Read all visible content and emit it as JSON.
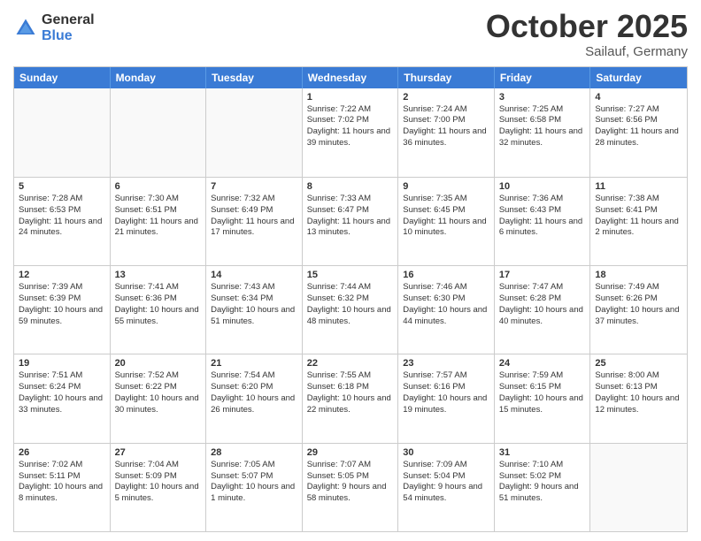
{
  "header": {
    "logo": {
      "general": "General",
      "blue": "Blue"
    },
    "title": "October 2025",
    "subtitle": "Sailauf, Germany"
  },
  "days_of_week": [
    "Sunday",
    "Monday",
    "Tuesday",
    "Wednesday",
    "Thursday",
    "Friday",
    "Saturday"
  ],
  "weeks": [
    [
      {
        "num": "",
        "empty": true
      },
      {
        "num": "",
        "empty": true
      },
      {
        "num": "",
        "empty": true
      },
      {
        "num": "1",
        "sunrise": "Sunrise: 7:22 AM",
        "sunset": "Sunset: 7:02 PM",
        "daylight": "Daylight: 11 hours and 39 minutes."
      },
      {
        "num": "2",
        "sunrise": "Sunrise: 7:24 AM",
        "sunset": "Sunset: 7:00 PM",
        "daylight": "Daylight: 11 hours and 36 minutes."
      },
      {
        "num": "3",
        "sunrise": "Sunrise: 7:25 AM",
        "sunset": "Sunset: 6:58 PM",
        "daylight": "Daylight: 11 hours and 32 minutes."
      },
      {
        "num": "4",
        "sunrise": "Sunrise: 7:27 AM",
        "sunset": "Sunset: 6:56 PM",
        "daylight": "Daylight: 11 hours and 28 minutes."
      }
    ],
    [
      {
        "num": "5",
        "sunrise": "Sunrise: 7:28 AM",
        "sunset": "Sunset: 6:53 PM",
        "daylight": "Daylight: 11 hours and 24 minutes."
      },
      {
        "num": "6",
        "sunrise": "Sunrise: 7:30 AM",
        "sunset": "Sunset: 6:51 PM",
        "daylight": "Daylight: 11 hours and 21 minutes."
      },
      {
        "num": "7",
        "sunrise": "Sunrise: 7:32 AM",
        "sunset": "Sunset: 6:49 PM",
        "daylight": "Daylight: 11 hours and 17 minutes."
      },
      {
        "num": "8",
        "sunrise": "Sunrise: 7:33 AM",
        "sunset": "Sunset: 6:47 PM",
        "daylight": "Daylight: 11 hours and 13 minutes."
      },
      {
        "num": "9",
        "sunrise": "Sunrise: 7:35 AM",
        "sunset": "Sunset: 6:45 PM",
        "daylight": "Daylight: 11 hours and 10 minutes."
      },
      {
        "num": "10",
        "sunrise": "Sunrise: 7:36 AM",
        "sunset": "Sunset: 6:43 PM",
        "daylight": "Daylight: 11 hours and 6 minutes."
      },
      {
        "num": "11",
        "sunrise": "Sunrise: 7:38 AM",
        "sunset": "Sunset: 6:41 PM",
        "daylight": "Daylight: 11 hours and 2 minutes."
      }
    ],
    [
      {
        "num": "12",
        "sunrise": "Sunrise: 7:39 AM",
        "sunset": "Sunset: 6:39 PM",
        "daylight": "Daylight: 10 hours and 59 minutes."
      },
      {
        "num": "13",
        "sunrise": "Sunrise: 7:41 AM",
        "sunset": "Sunset: 6:36 PM",
        "daylight": "Daylight: 10 hours and 55 minutes."
      },
      {
        "num": "14",
        "sunrise": "Sunrise: 7:43 AM",
        "sunset": "Sunset: 6:34 PM",
        "daylight": "Daylight: 10 hours and 51 minutes."
      },
      {
        "num": "15",
        "sunrise": "Sunrise: 7:44 AM",
        "sunset": "Sunset: 6:32 PM",
        "daylight": "Daylight: 10 hours and 48 minutes."
      },
      {
        "num": "16",
        "sunrise": "Sunrise: 7:46 AM",
        "sunset": "Sunset: 6:30 PM",
        "daylight": "Daylight: 10 hours and 44 minutes."
      },
      {
        "num": "17",
        "sunrise": "Sunrise: 7:47 AM",
        "sunset": "Sunset: 6:28 PM",
        "daylight": "Daylight: 10 hours and 40 minutes."
      },
      {
        "num": "18",
        "sunrise": "Sunrise: 7:49 AM",
        "sunset": "Sunset: 6:26 PM",
        "daylight": "Daylight: 10 hours and 37 minutes."
      }
    ],
    [
      {
        "num": "19",
        "sunrise": "Sunrise: 7:51 AM",
        "sunset": "Sunset: 6:24 PM",
        "daylight": "Daylight: 10 hours and 33 minutes."
      },
      {
        "num": "20",
        "sunrise": "Sunrise: 7:52 AM",
        "sunset": "Sunset: 6:22 PM",
        "daylight": "Daylight: 10 hours and 30 minutes."
      },
      {
        "num": "21",
        "sunrise": "Sunrise: 7:54 AM",
        "sunset": "Sunset: 6:20 PM",
        "daylight": "Daylight: 10 hours and 26 minutes."
      },
      {
        "num": "22",
        "sunrise": "Sunrise: 7:55 AM",
        "sunset": "Sunset: 6:18 PM",
        "daylight": "Daylight: 10 hours and 22 minutes."
      },
      {
        "num": "23",
        "sunrise": "Sunrise: 7:57 AM",
        "sunset": "Sunset: 6:16 PM",
        "daylight": "Daylight: 10 hours and 19 minutes."
      },
      {
        "num": "24",
        "sunrise": "Sunrise: 7:59 AM",
        "sunset": "Sunset: 6:15 PM",
        "daylight": "Daylight: 10 hours and 15 minutes."
      },
      {
        "num": "25",
        "sunrise": "Sunrise: 8:00 AM",
        "sunset": "Sunset: 6:13 PM",
        "daylight": "Daylight: 10 hours and 12 minutes."
      }
    ],
    [
      {
        "num": "26",
        "sunrise": "Sunrise: 7:02 AM",
        "sunset": "Sunset: 5:11 PM",
        "daylight": "Daylight: 10 hours and 8 minutes."
      },
      {
        "num": "27",
        "sunrise": "Sunrise: 7:04 AM",
        "sunset": "Sunset: 5:09 PM",
        "daylight": "Daylight: 10 hours and 5 minutes."
      },
      {
        "num": "28",
        "sunrise": "Sunrise: 7:05 AM",
        "sunset": "Sunset: 5:07 PM",
        "daylight": "Daylight: 10 hours and 1 minute."
      },
      {
        "num": "29",
        "sunrise": "Sunrise: 7:07 AM",
        "sunset": "Sunset: 5:05 PM",
        "daylight": "Daylight: 9 hours and 58 minutes."
      },
      {
        "num": "30",
        "sunrise": "Sunrise: 7:09 AM",
        "sunset": "Sunset: 5:04 PM",
        "daylight": "Daylight: 9 hours and 54 minutes."
      },
      {
        "num": "31",
        "sunrise": "Sunrise: 7:10 AM",
        "sunset": "Sunset: 5:02 PM",
        "daylight": "Daylight: 9 hours and 51 minutes."
      },
      {
        "num": "",
        "empty": true
      }
    ]
  ]
}
